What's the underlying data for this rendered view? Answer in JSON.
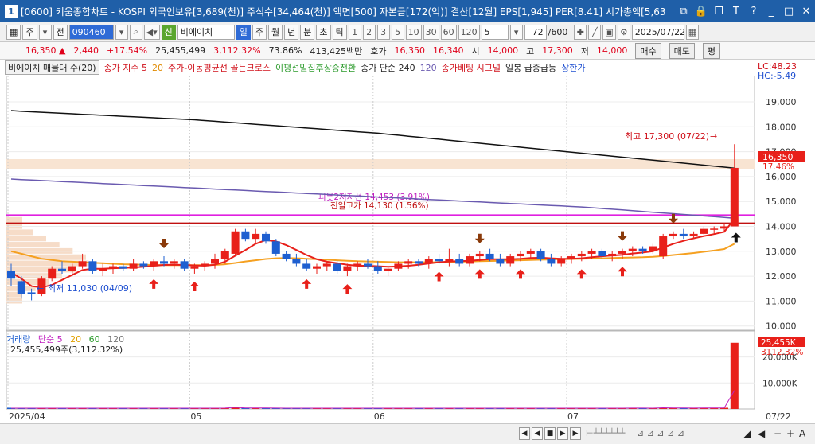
{
  "window": {
    "number": "1",
    "title": "[0600] 키움종합차트 - KOSPI 외국인보유[3,689(천)] 주식수[34,464(천)] 액면[500] 자본금[172(억)] 결산[12월] EPS[1,945] PER[8.41] 시가총액[5,63"
  },
  "toolbar": {
    "market": "주",
    "market2": "전",
    "code": "090460",
    "credit_badge": "신",
    "stock_name": "비에이치",
    "periods": [
      "일",
      "주",
      "월",
      "년",
      "분",
      "초",
      "틱"
    ],
    "active_period": "일",
    "minute_options": [
      "1",
      "2",
      "3",
      "5",
      "10",
      "30",
      "60",
      "120"
    ],
    "interval_value": "5",
    "count_value": "72",
    "count_total": "/600",
    "date": "2025/07/22"
  },
  "quote": {
    "price": "16,350",
    "change": "2,440",
    "change_pct": "+17.54%",
    "volume": "25,455,499",
    "volume_pct": "3,112.32%",
    "vol_ratio": "73.86%",
    "amount": "413,425백만",
    "ask_label": "호가",
    "ask": "16,350",
    "bid": "16,340",
    "open_label": "시",
    "open": "14,000",
    "high_label": "고",
    "high": "17,300",
    "low_label": "저",
    "low": "14,000",
    "buy_button": "매수",
    "sell_button": "매도",
    "extra_button": "평"
  },
  "legend": {
    "items": [
      {
        "text": "비에이치 매물대 수(20)",
        "color": "#333333"
      },
      {
        "text": "종가 지수 5",
        "color": "#d0101a"
      },
      {
        "text": "20",
        "color": "#e08a00"
      },
      {
        "text": "주가-이동평균선 골든크로스",
        "color": "#d0101a"
      },
      {
        "text": "이평선밀집후상승전환",
        "color": "#2a9a2a"
      },
      {
        "text": "종가 단순 240",
        "color": "#222222"
      },
      {
        "text": "120",
        "color": "#6a5ab0"
      },
      {
        "text": "종가베팅 시그널",
        "color": "#d0101a"
      },
      {
        "text": "일봉 급증급등",
        "color": "#222222"
      },
      {
        "text": "상한가",
        "color": "#1e4fd0"
      }
    ],
    "lc": "LC:48.23",
    "hc": "HC:-5.49"
  },
  "price_axis": {
    "ticks": [
      "19,000",
      "18,000",
      "17,000",
      "16,000",
      "15,000",
      "14,000",
      "13,000",
      "12,000",
      "11,000",
      "10,000"
    ],
    "current_price": "16,350",
    "current_pct": "17.46%"
  },
  "annotations": {
    "high": "최고 17,300 (07/22)",
    "low": "최저 11,030 (04/09)",
    "pivot": "피봇2저지선 14,453 (3.91%)",
    "prev_high": "전일고가 14,130 (1.56%)"
  },
  "volume": {
    "legend_name": "거래량",
    "legend_ma": "단순 5",
    "legend_p20": "20",
    "legend_p60": "60",
    "legend_p120": "120",
    "legend_sub": "25,455,499주(3,112.32%)",
    "axis_ticks": [
      "20,000K",
      "10,000K"
    ],
    "current": "25,455K",
    "current_pct": "3112.32%"
  },
  "date_axis": {
    "labels": [
      "2025/04",
      "05",
      "06",
      "07"
    ],
    "current": "07/22"
  },
  "colors": {
    "up": "#e8201a",
    "down": "#1e5fd0",
    "ma5": "#e8201a",
    "ma20": "#f5a020",
    "ma240": "#111111",
    "ma120": "#6a5ab0",
    "pivot": "#e020e0",
    "prev_high": "#c01010",
    "title_bar": "#1f5fa8"
  },
  "chart_data": {
    "type": "candlestick",
    "ylim": [
      9500,
      19500
    ],
    "ohlc": [
      [
        12200,
        12500,
        11600,
        11900
      ],
      [
        11800,
        12000,
        11100,
        11300
      ],
      [
        11350,
        11500,
        11030,
        11300
      ],
      [
        11300,
        12000,
        11200,
        11900
      ],
      [
        11900,
        12400,
        11800,
        12300
      ],
      [
        12300,
        12600,
        12100,
        12200
      ],
      [
        12200,
        12500,
        12000,
        12400
      ],
      [
        12400,
        12900,
        12300,
        12600
      ],
      [
        12600,
        12700,
        12100,
        12200
      ],
      [
        12200,
        12500,
        12000,
        12300
      ],
      [
        12300,
        12500,
        12100,
        12400
      ],
      [
        12400,
        12500,
        12200,
        12300
      ],
      [
        12300,
        12700,
        12200,
        12500
      ],
      [
        12500,
        12600,
        12300,
        12400
      ],
      [
        12400,
        12700,
        12200,
        12600
      ],
      [
        12600,
        12800,
        12400,
        12500
      ],
      [
        12500,
        12700,
        12300,
        12600
      ],
      [
        12600,
        12700,
        12200,
        12300
      ],
      [
        12300,
        12500,
        12100,
        12400
      ],
      [
        12400,
        12600,
        12200,
        12500
      ],
      [
        12500,
        12900,
        12300,
        12700
      ],
      [
        12700,
        13100,
        12500,
        13000
      ],
      [
        12900,
        13900,
        12800,
        13800
      ],
      [
        13800,
        13900,
        13400,
        13500
      ],
      [
        13500,
        13900,
        13300,
        13700
      ],
      [
        13700,
        13800,
        13300,
        13400
      ],
      [
        13400,
        13500,
        12800,
        12900
      ],
      [
        12900,
        13000,
        12600,
        12700
      ],
      [
        12700,
        12900,
        12400,
        12500
      ],
      [
        12500,
        12700,
        12200,
        12300
      ],
      [
        12300,
        12500,
        12100,
        12400
      ],
      [
        12400,
        12600,
        12200,
        12500
      ],
      [
        12500,
        12600,
        12100,
        12200
      ],
      [
        12200,
        12500,
        12000,
        12400
      ],
      [
        12400,
        12600,
        12200,
        12500
      ],
      [
        12500,
        12700,
        12300,
        12400
      ],
      [
        12400,
        12600,
        12100,
        12200
      ],
      [
        12200,
        12400,
        12000,
        12300
      ],
      [
        12300,
        12600,
        12200,
        12500
      ],
      [
        12500,
        12700,
        12300,
        12600
      ],
      [
        12600,
        12700,
        12400,
        12500
      ],
      [
        12500,
        12800,
        12300,
        12700
      ],
      [
        12700,
        12900,
        12500,
        12600
      ],
      [
        12600,
        13100,
        12400,
        12700
      ],
      [
        12700,
        12900,
        12400,
        12500
      ],
      [
        12500,
        12900,
        12400,
        12800
      ],
      [
        12800,
        13000,
        12600,
        12900
      ],
      [
        12900,
        13100,
        12600,
        12700
      ],
      [
        12700,
        12900,
        12400,
        12500
      ],
      [
        12500,
        12900,
        12400,
        12800
      ],
      [
        12800,
        13000,
        12600,
        12900
      ],
      [
        12900,
        13100,
        12700,
        13000
      ],
      [
        13000,
        13100,
        12600,
        12700
      ],
      [
        12700,
        12900,
        12400,
        12500
      ],
      [
        12500,
        12800,
        12400,
        12700
      ],
      [
        12700,
        12900,
        12500,
        12800
      ],
      [
        12800,
        13000,
        12600,
        12900
      ],
      [
        12900,
        13100,
        12700,
        13000
      ],
      [
        13000,
        13100,
        12700,
        12800
      ],
      [
        12800,
        13000,
        12600,
        12900
      ],
      [
        12900,
        13100,
        12700,
        13000
      ],
      [
        13000,
        13200,
        12800,
        13100
      ],
      [
        13100,
        13200,
        12900,
        13000
      ],
      [
        13000,
        13300,
        12900,
        13200
      ],
      [
        12800,
        13700,
        12700,
        13600
      ],
      [
        13600,
        13800,
        13500,
        13700
      ],
      [
        13700,
        13900,
        13500,
        13600
      ],
      [
        13600,
        13800,
        13500,
        13700
      ],
      [
        13700,
        14000,
        13600,
        13900
      ],
      [
        13900,
        14000,
        13700,
        13910
      ],
      [
        13910,
        14130,
        13800,
        14000
      ],
      [
        14000,
        17300,
        14000,
        16350
      ]
    ],
    "series": [
      {
        "name": "종가 지수 5",
        "values": [
          12150,
          11900,
          11600,
          11550,
          11650,
          11850,
          12050,
          12250,
          12300,
          12300,
          12320,
          12330,
          12350,
          12380,
          12420,
          12450,
          12460,
          12450,
          12430,
          12420,
          12460,
          12580,
          12820,
          13050,
          13300,
          13450,
          13400,
          13250,
          13050,
          12850,
          12680,
          12580,
          12520,
          12460,
          12420,
          12420,
          12400,
          12380,
          12390,
          12420,
          12460,
          12510,
          12560,
          12590,
          12600,
          12620,
          12650,
          12680,
          12680,
          12680,
          12700,
          12730,
          12740,
          12720,
          12700,
          12700,
          12720,
          12760,
          12800,
          12830,
          12860,
          12910,
          12950,
          13000,
          13150,
          13300,
          13420,
          13520,
          13610,
          13690,
          13780,
          14300
        ]
      },
      {
        "name": "20",
        "values": [
          13000,
          12900,
          12800,
          12700,
          12650,
          12600,
          12580,
          12560,
          12540,
          12520,
          12500,
          12480,
          12470,
          12460,
          12450,
          12440,
          12440,
          12440,
          12440,
          12440,
          12450,
          12480,
          12530,
          12590,
          12640,
          12690,
          12720,
          12730,
          12720,
          12700,
          12680,
          12660,
          12640,
          12620,
          12600,
          12590,
          12580,
          12570,
          12560,
          12560,
          12560,
          12560,
          12560,
          12570,
          12580,
          12590,
          12600,
          12610,
          12620,
          12630,
          12640,
          12650,
          12660,
          12670,
          12680,
          12690,
          12700,
          12710,
          12720,
          12730,
          12740,
          12750,
          12760,
          12780,
          12810,
          12850,
          12890,
          12930,
          12980,
          13030,
          13090,
          13300
        ]
      },
      {
        "name": "종가 단순 240",
        "values": [
          18650,
          18620,
          18600,
          18580,
          18560,
          18540,
          18520,
          18500,
          18480,
          18460,
          18440,
          18420,
          18400,
          18380,
          18360,
          18340,
          18320,
          18300,
          18280,
          18250,
          18220,
          18190,
          18160,
          18130,
          18100,
          18070,
          18040,
          18010,
          17980,
          17950,
          17920,
          17890,
          17860,
          17830,
          17800,
          17770,
          17740,
          17700,
          17660,
          17620,
          17580,
          17540,
          17500,
          17460,
          17420,
          17380,
          17340,
          17300,
          17260,
          17220,
          17180,
          17140,
          17100,
          17060,
          17020,
          16980,
          16940,
          16900,
          16860,
          16820,
          16780,
          16740,
          16700,
          16660,
          16620,
          16580,
          16540,
          16500,
          16460,
          16420,
          16380,
          16340
        ]
      },
      {
        "name": "120",
        "values": [
          15900,
          15880,
          15860,
          15840,
          15820,
          15800,
          15780,
          15760,
          15740,
          15720,
          15700,
          15680,
          15660,
          15640,
          15620,
          15600,
          15580,
          15560,
          15540,
          15520,
          15500,
          15480,
          15460,
          15440,
          15420,
          15400,
          15380,
          15360,
          15340,
          15320,
          15300,
          15280,
          15260,
          15240,
          15220,
          15200,
          15180,
          15160,
          15140,
          15120,
          15100,
          15080,
          15060,
          15040,
          15020,
          15000,
          14980,
          14960,
          14940,
          14920,
          14900,
          14880,
          14860,
          14840,
          14820,
          14800,
          14780,
          14750,
          14720,
          14690,
          14660,
          14630,
          14600,
          14570,
          14540,
          14510,
          14480,
          14450,
          14420,
          14390,
          14360,
          14330
        ]
      }
    ],
    "volume": [
      300,
      290,
      310,
      280,
      300,
      290,
      320,
      300,
      280,
      290,
      300,
      310,
      290,
      300,
      320,
      300,
      290,
      280,
      300,
      310,
      320,
      340,
      600,
      400,
      380,
      360,
      330,
      320,
      310,
      300,
      290,
      300,
      320,
      310,
      300,
      290,
      300,
      320,
      310,
      300,
      290,
      300,
      310,
      320,
      300,
      290,
      310,
      300,
      290,
      300,
      310,
      320,
      300,
      310,
      290,
      300,
      310,
      320,
      300,
      310,
      320,
      330,
      340,
      320,
      450,
      380,
      360,
      350,
      380,
      400,
      420,
      25455
    ],
    "ylim_volume": [
      0,
      26000
    ],
    "horizontal_lines": [
      14453,
      14130
    ],
    "extremes": {
      "high": 17300,
      "low": 11030
    }
  }
}
